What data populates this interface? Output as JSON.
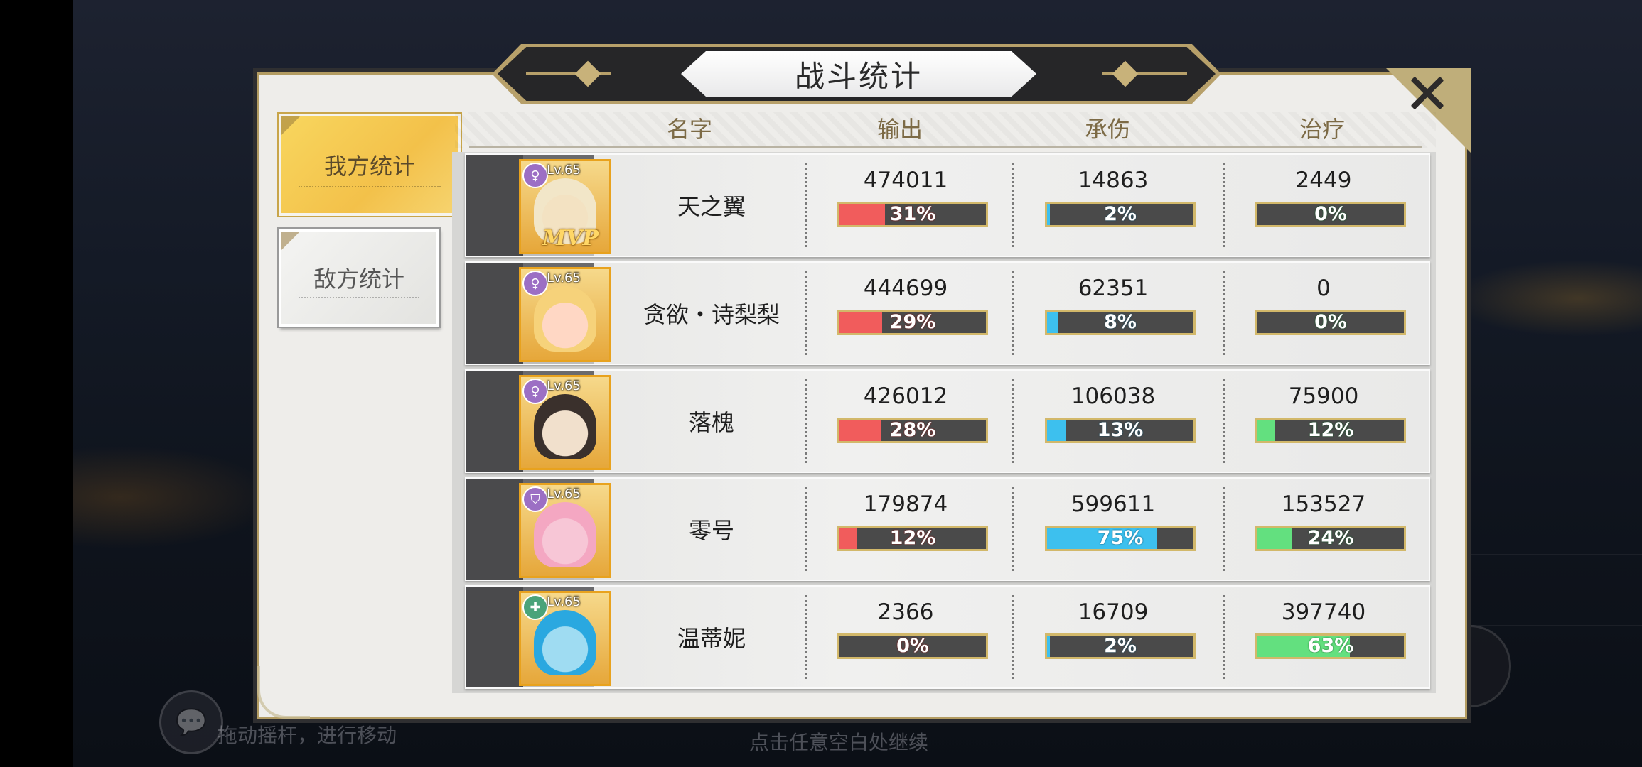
{
  "title": "战斗统计",
  "tabs": {
    "ally": "我方统计",
    "enemy": "敌方统计"
  },
  "headers": {
    "name": "名字",
    "output": "输出",
    "damage_taken": "承伤",
    "healing": "治疗"
  },
  "hints": {
    "joystick": "拖动摇杆，进行移动",
    "continue": "点击任意空白处继续"
  },
  "mvp_label": "MVP",
  "rows": [
    {
      "level": "Lv.65",
      "name": "天之翼",
      "class_icon": "female-symbol-icon",
      "output": "474011",
      "output_pct": "31%",
      "output_frac": 0.31,
      "taken": "14863",
      "taken_pct": "2%",
      "taken_frac": 0.02,
      "heal": "2449",
      "heal_pct": "0%",
      "heal_frac": 0.0
    },
    {
      "level": "Lv.65",
      "name": "贪欲・诗梨梨",
      "class_icon": "female-symbol-icon",
      "output": "444699",
      "output_pct": "29%",
      "output_frac": 0.29,
      "taken": "62351",
      "taken_pct": "8%",
      "taken_frac": 0.08,
      "heal": "0",
      "heal_pct": "0%",
      "heal_frac": 0.0
    },
    {
      "level": "Lv.65",
      "name": "落槐",
      "class_icon": "female-symbol-icon",
      "output": "426012",
      "output_pct": "28%",
      "output_frac": 0.28,
      "taken": "106038",
      "taken_pct": "13%",
      "taken_frac": 0.13,
      "heal": "75900",
      "heal_pct": "12%",
      "heal_frac": 0.12
    },
    {
      "level": "Lv.65",
      "name": "零号",
      "class_icon": "shield-icon",
      "output": "179874",
      "output_pct": "12%",
      "output_frac": 0.12,
      "taken": "599611",
      "taken_pct": "75%",
      "taken_frac": 0.75,
      "heal": "153527",
      "heal_pct": "24%",
      "heal_frac": 0.24
    },
    {
      "level": "Lv.65",
      "name": "温蒂妮",
      "class_icon": "heal-cross-icon",
      "output": "2366",
      "output_pct": "0%",
      "output_frac": 0.0,
      "taken": "16709",
      "taken_pct": "2%",
      "taken_frac": 0.02,
      "heal": "397740",
      "heal_pct": "63%",
      "heal_frac": 0.63
    }
  ]
}
